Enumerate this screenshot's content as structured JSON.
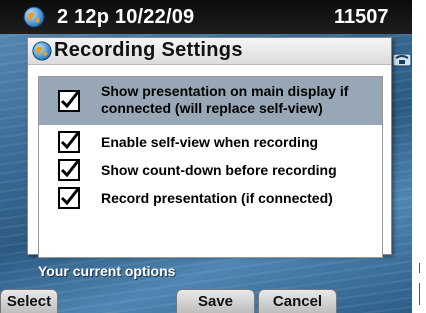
{
  "status_bar": {
    "datetime": "2 12p 10/22/09",
    "extension": "11507"
  },
  "dialog": {
    "title": "Recording Settings",
    "options": [
      {
        "label_lines": [
          "Show presentation on main display if",
          "connected (will replace self-view)"
        ],
        "checked": true,
        "selected": true
      },
      {
        "label": "Enable self-view when recording",
        "checked": true,
        "selected": false
      },
      {
        "label": "Show count-down before recording",
        "checked": true,
        "selected": false
      },
      {
        "label": "Record presentation (if connected)",
        "checked": true,
        "selected": false
      }
    ]
  },
  "footer": {
    "prompt": "Your current options"
  },
  "softkeys": {
    "select": "Select",
    "save": "Save",
    "cancel": "Cancel"
  },
  "icons": {
    "status_globe": "globe-icon",
    "dialog_globe": "globe-icon",
    "phone": "phone-icon",
    "checkbox": "checkmark-icon"
  },
  "colors": {
    "selected_row": "#98a7b5",
    "status_bar": "#111111",
    "background": "#3d6f99"
  }
}
